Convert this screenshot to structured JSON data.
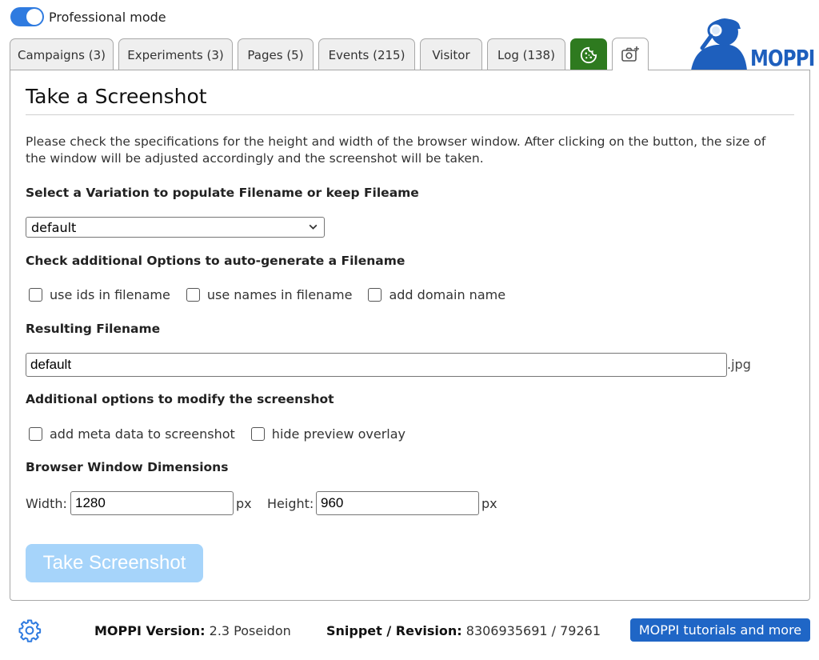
{
  "top": {
    "pro_mode_label": "Professional mode"
  },
  "tabs": [
    {
      "label": "Campaigns (3)"
    },
    {
      "label": "Experiments (3)"
    },
    {
      "label": "Pages (5)"
    },
    {
      "label": "Events (215)"
    },
    {
      "label": "Visitor"
    },
    {
      "label": "Log (138)"
    }
  ],
  "logo": {
    "text": "MOPPI"
  },
  "colors": {
    "accent": "#2f7be0",
    "cookie_tab": "#2e7a1f",
    "logo_blue": "#1e5fbd",
    "button_disabled": "#a6d4fa",
    "tutorial": "#1f66c6"
  },
  "main": {
    "title": "Take a Screenshot",
    "intro": "Please check the specifications for the height and width of the browser window. After clicking on the button, the size of the window will be adjusted accordingly and the screenshot will be taken.",
    "variation_label": "Select a Variation to populate Filename or keep Fileame",
    "variation_selected": "default",
    "options_label": "Check additional Options to auto-generate a Filename",
    "option_ids": "use ids in filename",
    "option_names": "use names in filename",
    "option_domain": "add domain name",
    "filename_label": "Resulting Filename",
    "filename_value": "default",
    "filename_suffix": ".jpg",
    "modify_label": "Additional options to modify the screenshot",
    "option_meta": "add meta data to screenshot",
    "option_hide_overlay": "hide preview overlay",
    "dimensions_label": "Browser Window Dimensions",
    "width_label": "Width:",
    "width_value": "1280",
    "height_label": "Height:",
    "height_value": "960",
    "px_unit": "px",
    "button_label": "Take Screenshot"
  },
  "footer": {
    "version_label": "MOPPI Version:",
    "version_value": "2.3 Poseidon",
    "snippet_label": "Snippet / Revision:",
    "snippet_value": "8306935691 / 79261",
    "tutorials_label": "MOPPI tutorials and more"
  }
}
